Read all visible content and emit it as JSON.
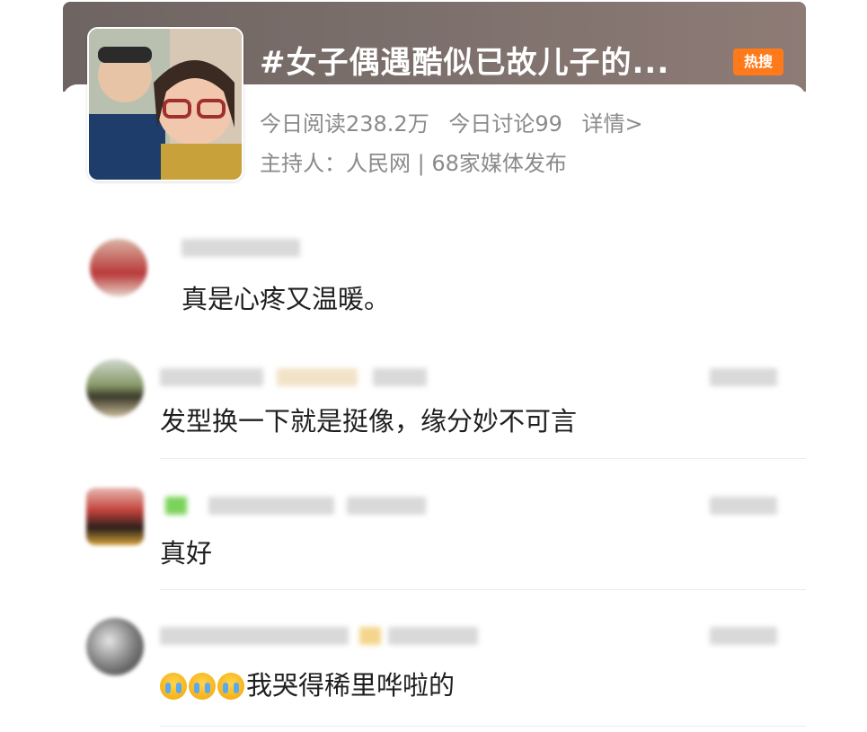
{
  "topic": {
    "title": "#女子偶遇酷似已故儿子的...",
    "badge": "热搜",
    "reads": "今日阅读238.2万",
    "discussions": "今日讨论99",
    "details": "详情>",
    "host": "主持人：人民网 | 68家媒体发布"
  },
  "comments": [
    {
      "text": "真是心疼又温暖。"
    },
    {
      "text": "发型换一下就是挺像，缘分妙不可言"
    },
    {
      "text": "真好"
    },
    {
      "emoji": "crying-face-icon",
      "text": "我哭得稀里哗啦的"
    }
  ],
  "colors": {
    "header": "#7b6f6b",
    "hot_badge": "#ff7a1a",
    "meta_text": "#8a8a8a"
  }
}
